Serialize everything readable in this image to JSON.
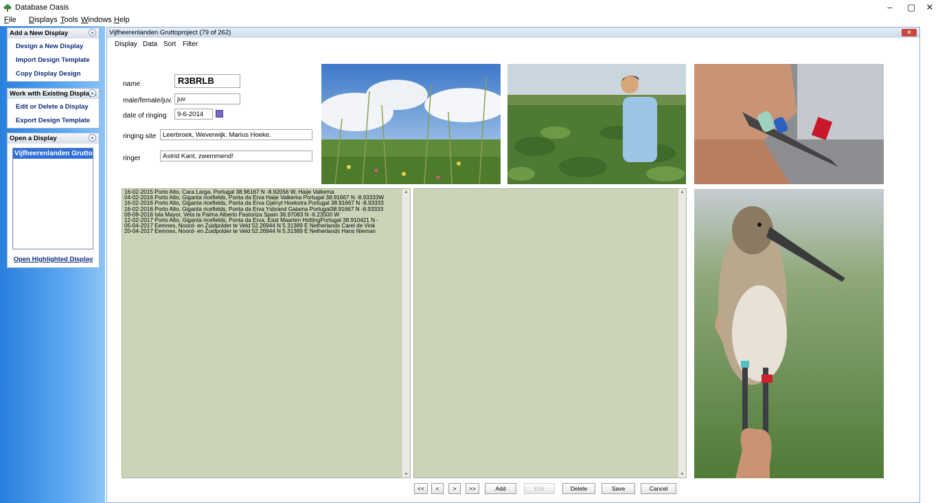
{
  "app": {
    "title": "Database Oasis",
    "window_controls": {
      "minimize": "–",
      "maximize": "▢",
      "close": "✕"
    }
  },
  "menubar": [
    {
      "label": "File",
      "ul": "F",
      "rest": "ile"
    },
    {
      "label": "Displays",
      "ul": "D",
      "rest": "isplays"
    },
    {
      "label": "Tools",
      "ul": "T",
      "rest": "ools"
    },
    {
      "label": "Windows",
      "ul": "W",
      "rest": "indows"
    },
    {
      "label": "Help",
      "ul": "H",
      "rest": "elp"
    }
  ],
  "sidebar": {
    "add_panel": {
      "header": "Add a New Display",
      "items": [
        "Design a New Display",
        "Import Design Template",
        "Copy Display Design"
      ]
    },
    "existing_panel": {
      "header": "Work with Existing Displays",
      "items": [
        "Edit or Delete a Display",
        "Export Design Template"
      ]
    },
    "open_panel": {
      "header": "Open a Display",
      "list_selected": "Vijfheerenlanden Gruttoproject",
      "open_button": "Open Highlighted Display"
    },
    "collapse_glyph": "»"
  },
  "child": {
    "title": "Vijfheerenlanden Gruttoproject  (79 of 262)",
    "close_glyph": "✕",
    "menu": [
      "Display",
      "Data",
      "Sort",
      "Filter"
    ]
  },
  "form": {
    "name_label": "name",
    "name_value": "R3BRLB",
    "sex_label": "male/female/juv.",
    "sex_value": "juv",
    "date_label": "date of ringing",
    "date_value": "9-6-2014",
    "site_label": "ringing site",
    "site_value": "Leerbroek, Weverwijk. Marius Hoeke.",
    "ringer_label": "ringer",
    "ringer_value": "Astrid Kant, zwemmend!"
  },
  "records": [
    "16-02-2015 Porto Alto, Cara Larga, Portugal 38.96167 N -8.92056 W,  Haije Valkema",
    "04-02-2016 Porto Alto, Giganta ricefields, Ponta da Erva Haije Valkema Portugal 38.91667 N -8.93333W",
    "16-02-2016 Porto Alto, Giganta ricefields, Ponta da Erva Gjerryt Hoekstra Portugal 38.91667 N -8.93333",
    "16-02-2016 Porto Alto, Giganta ricefields, Ponta da Erva Ysbrand Galama Portugal38.91667 N -8.93333",
    "09-08-2016 Isla Mayor, Veta la Palma Alberto Pastoriza Spain 36.97083 N -6.23500 W",
    "12-02-2017 Porto Alto, Giganta ricefields, Ponta da Erva, East Maarten HottingPortugal 38.910421 N -",
    "05-04-2017 Eemnes, Noord- en Zuidpolder te Veld 52.26944 N 5.31389 E  Netherlands Carel de Vink",
    "20-04-2017 Eemnes, Noord- en Zuidpolder te Veld 52.26944 N 5.31389 E  Netherlands Hans Nieman"
  ],
  "nav": {
    "first": "<<",
    "prev": "<",
    "next": ">",
    "last": ">>",
    "add": "Add",
    "edit": "Edit",
    "delete": "Delete",
    "save": "Save",
    "cancel": "Cancel"
  },
  "scroll_glyphs": {
    "up": "▲",
    "down": "▼"
  },
  "colors": {
    "sidebar_blue": "#2a7fde",
    "selection_blue": "#2f6fd8",
    "textarea_olive": "#cbd4b8",
    "close_red": "#c8473a"
  }
}
